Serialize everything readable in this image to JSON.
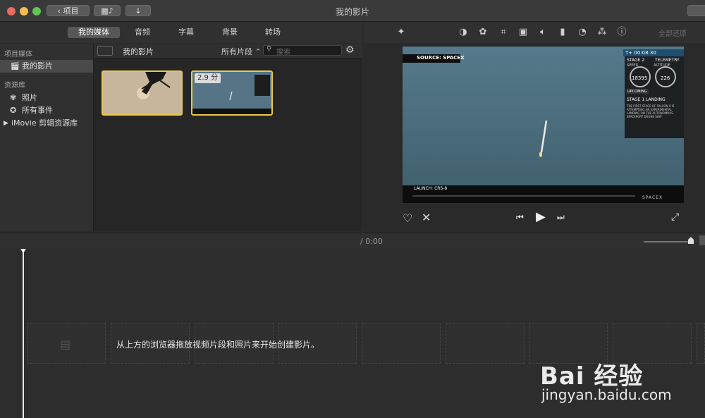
{
  "window": {
    "title": "我的影片"
  },
  "toolbar": {
    "back_label": "项目",
    "tabs": [
      "我的媒体",
      "音频",
      "字幕",
      "背景",
      "转场"
    ],
    "reset_all": "全部还原"
  },
  "sidebar": {
    "section_project_media": "项目媒体",
    "my_movie": "我的影片",
    "section_libraries": "资源库",
    "photos": "照片",
    "all_events": "所有事件",
    "imovie_library": "iMovie 剪辑资源库"
  },
  "browser": {
    "title": "我的影片",
    "filter": "所有片段",
    "search_placeholder": "搜索",
    "clip_duration": "2.9 分"
  },
  "video": {
    "source": "SOURCE: SPACEX",
    "timer": "T+ 00:08:30",
    "stage": "STAGE 2",
    "telemetry": "TELEMETRY",
    "speed_label": "SPEED",
    "altitude_label": "ALTITUDE",
    "speed_value": "18395",
    "altitude_value": "226",
    "upcoming": "UPCOMING",
    "event_title": "STAGE 1 LANDING",
    "event_desc": "THE FIRST STAGE OF FALCON 9 IS ATTEMPTING AN EXPERIMENTAL LANDING ON THE AUTONOMOUS SPACEPORT DRONE SHIP",
    "launch": "LAUNCH: CRS-8",
    "brand": "SPACEX"
  },
  "timeline": {
    "timecode": "/ 0:00",
    "hint": "从上方的浏览器拖放视频片段和照片来开始创建影片。"
  },
  "watermark": {
    "text": "Bai 经验",
    "url": "jingyan.baidu.com"
  },
  "colors": {
    "accent_yellow": "#e8c94a",
    "close": "#ec6a5e",
    "minimize": "#f4bf4f",
    "zoom": "#61c554"
  }
}
